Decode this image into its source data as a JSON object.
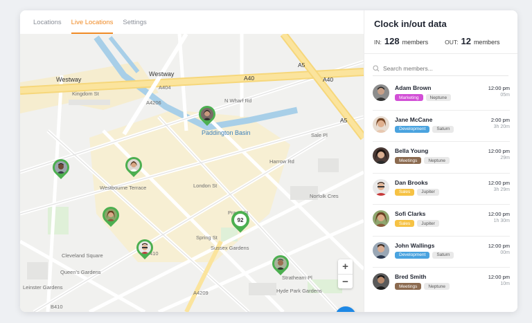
{
  "tabs": [
    {
      "label": "Locations",
      "active": false
    },
    {
      "label": "Live Locations",
      "active": true
    },
    {
      "label": "Settings",
      "active": false
    }
  ],
  "map": {
    "street_labels": [
      "Westway",
      "Westway",
      "A40",
      "A40",
      "A5",
      "A5",
      "A404",
      "A4206",
      "Paddington Basin",
      "Kingdom St",
      "N Wharf Rd",
      "Harrow Rd",
      "Westbourne Terrace",
      "London St",
      "Sussex Gardens",
      "Spring St",
      "Praed St",
      "B410",
      "B410",
      "A4209",
      "Hyde Park Gardens",
      "Queen's Gardens",
      "Cleveland Square",
      "Leinster Gardens",
      "Sale Pl",
      "Norfolk Cres",
      "Strathearn Pl"
    ],
    "cluster_count": "92",
    "zoom_in": "+",
    "zoom_out": "−"
  },
  "panel": {
    "title": "Clock in/out data",
    "in_label": "IN:",
    "in_count": "128",
    "in_unit": "members",
    "out_label": "OUT:",
    "out_count": "12",
    "out_unit": "members",
    "search_placeholder": "Search members..."
  },
  "members": [
    {
      "name": "Adam Brown",
      "tag1": "Marketing",
      "tag1_color": "#d24fd6",
      "tag2": "Neptune",
      "time": "12:00 pm",
      "duration": "05m"
    },
    {
      "name": "Jane McCane",
      "tag1": "Development",
      "tag1_color": "#4aa3df",
      "tag2": "Saturn",
      "time": "2:00 pm",
      "duration": "3h 20m"
    },
    {
      "name": "Bella Young",
      "tag1": "Meetings",
      "tag1_color": "#8b6a4f",
      "tag2": "Neptune",
      "time": "12:00 pm",
      "duration": "29m"
    },
    {
      "name": "Dan Brooks",
      "tag1": "Sales",
      "tag1_color": "#f6c244",
      "tag2": "Jupiter",
      "time": "12:00 pm",
      "duration": "3h 29m"
    },
    {
      "name": "Sofi Clarks",
      "tag1": "Sales",
      "tag1_color": "#f6c244",
      "tag2": "Jupiter",
      "time": "12:00 pm",
      "duration": "1h 30m"
    },
    {
      "name": "John Wallings",
      "tag1": "Development",
      "tag1_color": "#4aa3df",
      "tag2": "Saturn",
      "time": "12:00 pm",
      "duration": "00m"
    },
    {
      "name": "Bred Smith",
      "tag1": "Meetings",
      "tag1_color": "#8b6a4f",
      "tag2": "Neptune",
      "time": "12:00 pm",
      "duration": "10m"
    }
  ],
  "colors": {
    "accent": "#f08a24",
    "pin": "#4caf50",
    "chat": "#1e88e5"
  }
}
